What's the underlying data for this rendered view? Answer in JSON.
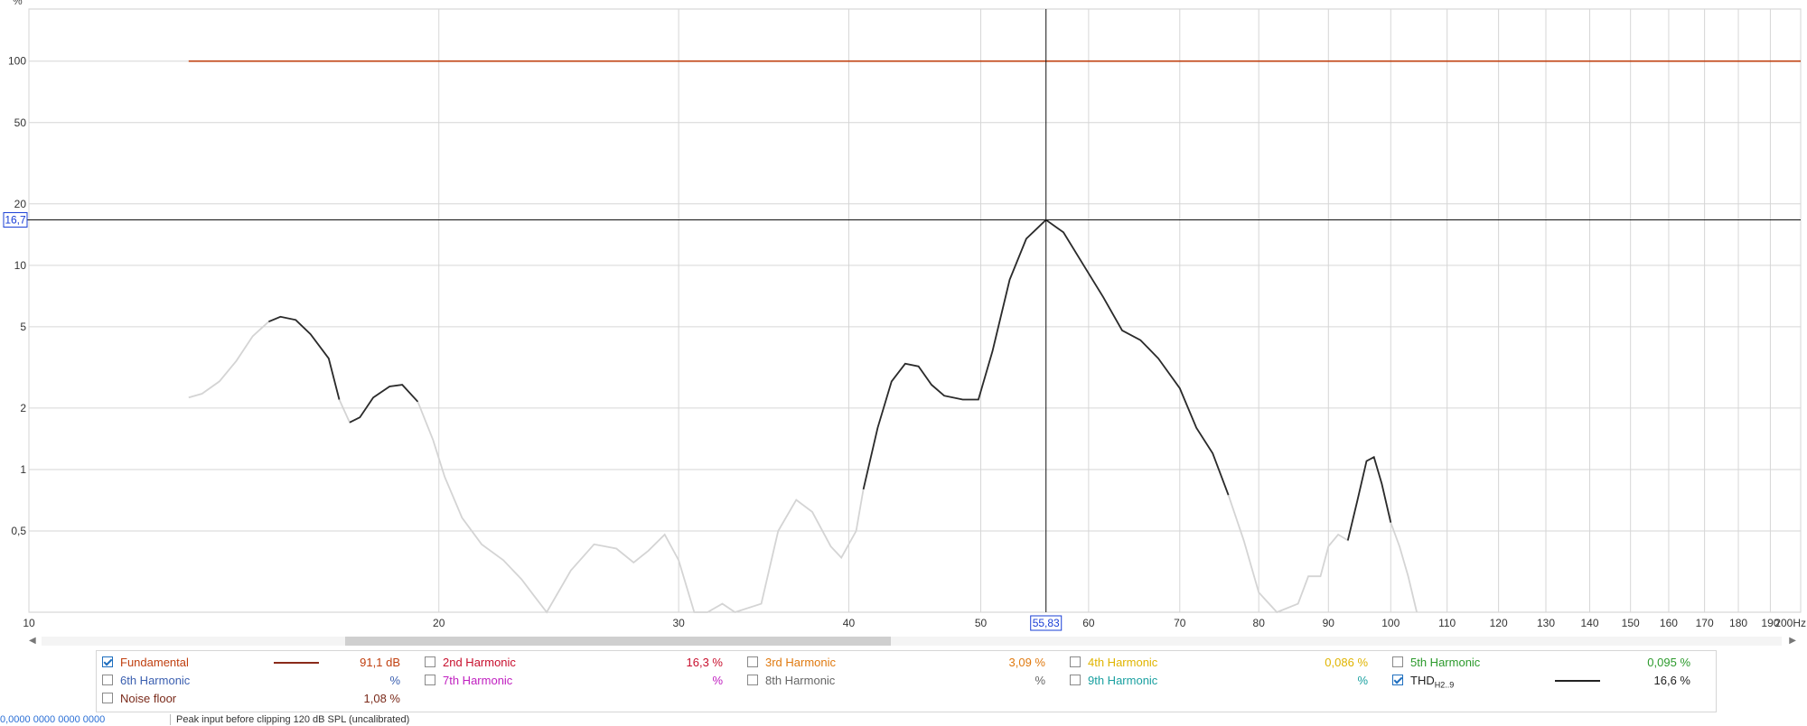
{
  "chart_data": {
    "type": "line",
    "y_unit_label": "%",
    "y_scale": "log",
    "x_scale": "log",
    "ylim": [
      0.2,
      180
    ],
    "xlim": [
      10,
      200
    ],
    "y_ticks": [
      {
        "v": 100,
        "label": "100"
      },
      {
        "v": 50,
        "label": "50"
      },
      {
        "v": 20,
        "label": "20"
      },
      {
        "v": 10,
        "label": "10"
      },
      {
        "v": 5,
        "label": "5"
      },
      {
        "v": 2,
        "label": "2"
      },
      {
        "v": 1,
        "label": "1"
      },
      {
        "v": 0.5,
        "label": "0,5"
      }
    ],
    "x_ticks": [
      {
        "v": 10,
        "label": "10"
      },
      {
        "v": 20,
        "label": "20"
      },
      {
        "v": 30,
        "label": "30"
      },
      {
        "v": 40,
        "label": "40"
      },
      {
        "v": 50,
        "label": "50"
      },
      {
        "v": 60,
        "label": "60"
      },
      {
        "v": 70,
        "label": "70"
      },
      {
        "v": 80,
        "label": "80"
      },
      {
        "v": 90,
        "label": "90"
      },
      {
        "v": 100,
        "label": "100"
      },
      {
        "v": 110,
        "label": "110"
      },
      {
        "v": 120,
        "label": "120"
      },
      {
        "v": 130,
        "label": "130"
      },
      {
        "v": 140,
        "label": "140"
      },
      {
        "v": 150,
        "label": "150"
      },
      {
        "v": 160,
        "label": "160"
      },
      {
        "v": 170,
        "label": "170"
      },
      {
        "v": 180,
        "label": "180"
      },
      {
        "v": 190,
        "label": "190"
      },
      {
        "v": 200,
        "label": "200Hz"
      }
    ],
    "grid": true,
    "cursor": {
      "x": 55.83,
      "y": 16.7,
      "x_label": "55,83",
      "y_label": "16,7"
    },
    "colors": {
      "fundamental": "#c04010",
      "thd_dark": "#2b2b2b",
      "thd_light": "#d4d4d4",
      "cursor_label": "#1a3fd6"
    },
    "series": [
      {
        "name": "Fundamental",
        "points": [
          [
            13.1,
            100
          ],
          [
            200,
            100
          ]
        ]
      },
      {
        "name": "THD",
        "points": [
          [
            13.1,
            2.25
          ],
          [
            13.4,
            2.35
          ],
          [
            13.8,
            2.7
          ],
          [
            14.2,
            3.4
          ],
          [
            14.6,
            4.5
          ],
          [
            15.0,
            5.3
          ],
          [
            15.3,
            5.6
          ],
          [
            15.7,
            5.4
          ],
          [
            16.1,
            4.6
          ],
          [
            16.6,
            3.5
          ],
          [
            16.9,
            2.2
          ],
          [
            17.2,
            1.7
          ],
          [
            17.5,
            1.8
          ],
          [
            17.9,
            2.25
          ],
          [
            18.4,
            2.55
          ],
          [
            18.8,
            2.6
          ],
          [
            19.3,
            2.15
          ],
          [
            19.8,
            1.4
          ],
          [
            20.2,
            0.92
          ],
          [
            20.8,
            0.58
          ],
          [
            21.5,
            0.43
          ],
          [
            22.3,
            0.36
          ],
          [
            23.0,
            0.29
          ],
          [
            23.5,
            0.24
          ],
          [
            24.0,
            0.2
          ],
          [
            25.0,
            0.32
          ],
          [
            26.0,
            0.43
          ],
          [
            27.0,
            0.41
          ],
          [
            27.8,
            0.35
          ],
          [
            28.5,
            0.4
          ],
          [
            29.3,
            0.48
          ],
          [
            30.0,
            0.36
          ],
          [
            30.8,
            0.2
          ],
          [
            31.5,
            0.2
          ],
          [
            32.3,
            0.22
          ],
          [
            33.0,
            0.2
          ],
          [
            34.5,
            0.22
          ],
          [
            35.5,
            0.5
          ],
          [
            36.6,
            0.71
          ],
          [
            37.6,
            0.62
          ],
          [
            38.8,
            0.42
          ],
          [
            39.5,
            0.37
          ],
          [
            40.5,
            0.5
          ],
          [
            41.0,
            0.8
          ],
          [
            42.0,
            1.6
          ],
          [
            43.0,
            2.7
          ],
          [
            44.0,
            3.3
          ],
          [
            45.0,
            3.2
          ],
          [
            46.0,
            2.6
          ],
          [
            47.0,
            2.3
          ],
          [
            48.5,
            2.2
          ],
          [
            49.8,
            2.2
          ],
          [
            51.0,
            3.8
          ],
          [
            52.5,
            8.5
          ],
          [
            54.0,
            13.5
          ],
          [
            55.83,
            16.7
          ],
          [
            57.5,
            14.5
          ],
          [
            59.5,
            10.0
          ],
          [
            61.5,
            7.0
          ],
          [
            63.5,
            4.8
          ],
          [
            65.5,
            4.3
          ],
          [
            67.5,
            3.5
          ],
          [
            70.0,
            2.5
          ],
          [
            72.0,
            1.6
          ],
          [
            74.0,
            1.2
          ],
          [
            76.0,
            0.75
          ],
          [
            78.0,
            0.45
          ],
          [
            80.0,
            0.25
          ],
          [
            82.5,
            0.2
          ],
          [
            85.5,
            0.22
          ],
          [
            87.0,
            0.3
          ],
          [
            88.8,
            0.3
          ],
          [
            90.0,
            0.42
          ],
          [
            91.5,
            0.48
          ],
          [
            93.0,
            0.45
          ],
          [
            94.5,
            0.7
          ],
          [
            96.0,
            1.1
          ],
          [
            97.2,
            1.15
          ],
          [
            98.5,
            0.85
          ],
          [
            100.0,
            0.55
          ],
          [
            101.5,
            0.42
          ],
          [
            103.0,
            0.3
          ],
          [
            104.5,
            0.2
          ]
        ],
        "dark_ranges": [
          [
            15.0,
            16.9
          ],
          [
            17.2,
            19.3
          ],
          [
            41.0,
            77.0
          ],
          [
            93.0,
            100.0
          ]
        ]
      }
    ]
  },
  "scrollbar": {
    "left_arrow": "◀",
    "right_arrow": "▶"
  },
  "legend": {
    "items": [
      {
        "id": "fundamental",
        "label": "Fundamental",
        "value": "91,1 dB",
        "checked": true,
        "color": "#c04010",
        "line": "#8a2a1a"
      },
      {
        "id": "h2",
        "label": "2nd Harmonic",
        "value": "16,3 %",
        "checked": false,
        "color": "#c8102e"
      },
      {
        "id": "h3",
        "label": "3rd Harmonic",
        "value": "3,09 %",
        "checked": false,
        "color": "#e07a10"
      },
      {
        "id": "h4",
        "label": "4th Harmonic",
        "value": "0,086 %",
        "checked": false,
        "color": "#e0b400"
      },
      {
        "id": "h5",
        "label": "5th Harmonic",
        "value": "0,095 %",
        "checked": false,
        "color": "#2c9a2c"
      },
      {
        "id": "h6",
        "label": "6th Harmonic",
        "value": "%",
        "checked": false,
        "color": "#3b5fb0"
      },
      {
        "id": "h7",
        "label": "7th Harmonic",
        "value": "%",
        "checked": false,
        "color": "#c020c0"
      },
      {
        "id": "h8",
        "label": "8th Harmonic",
        "value": "%",
        "checked": false,
        "color": "#666666"
      },
      {
        "id": "h9",
        "label": "9th Harmonic",
        "value": "%",
        "checked": false,
        "color": "#1aa0a0"
      },
      {
        "id": "thd",
        "label": "THD",
        "sub": "H2..9",
        "value": "16,6 %",
        "checked": true,
        "color": "#222222",
        "line": "#222222"
      },
      {
        "id": "noise",
        "label": "Noise floor",
        "value": "1,08 %",
        "checked": false,
        "color": "#7a2a1a"
      }
    ]
  },
  "status": {
    "left": "0,0000 0000 0000 0000",
    "mid": "Peak input before clipping 120 dB SPL (uncalibrated)"
  }
}
